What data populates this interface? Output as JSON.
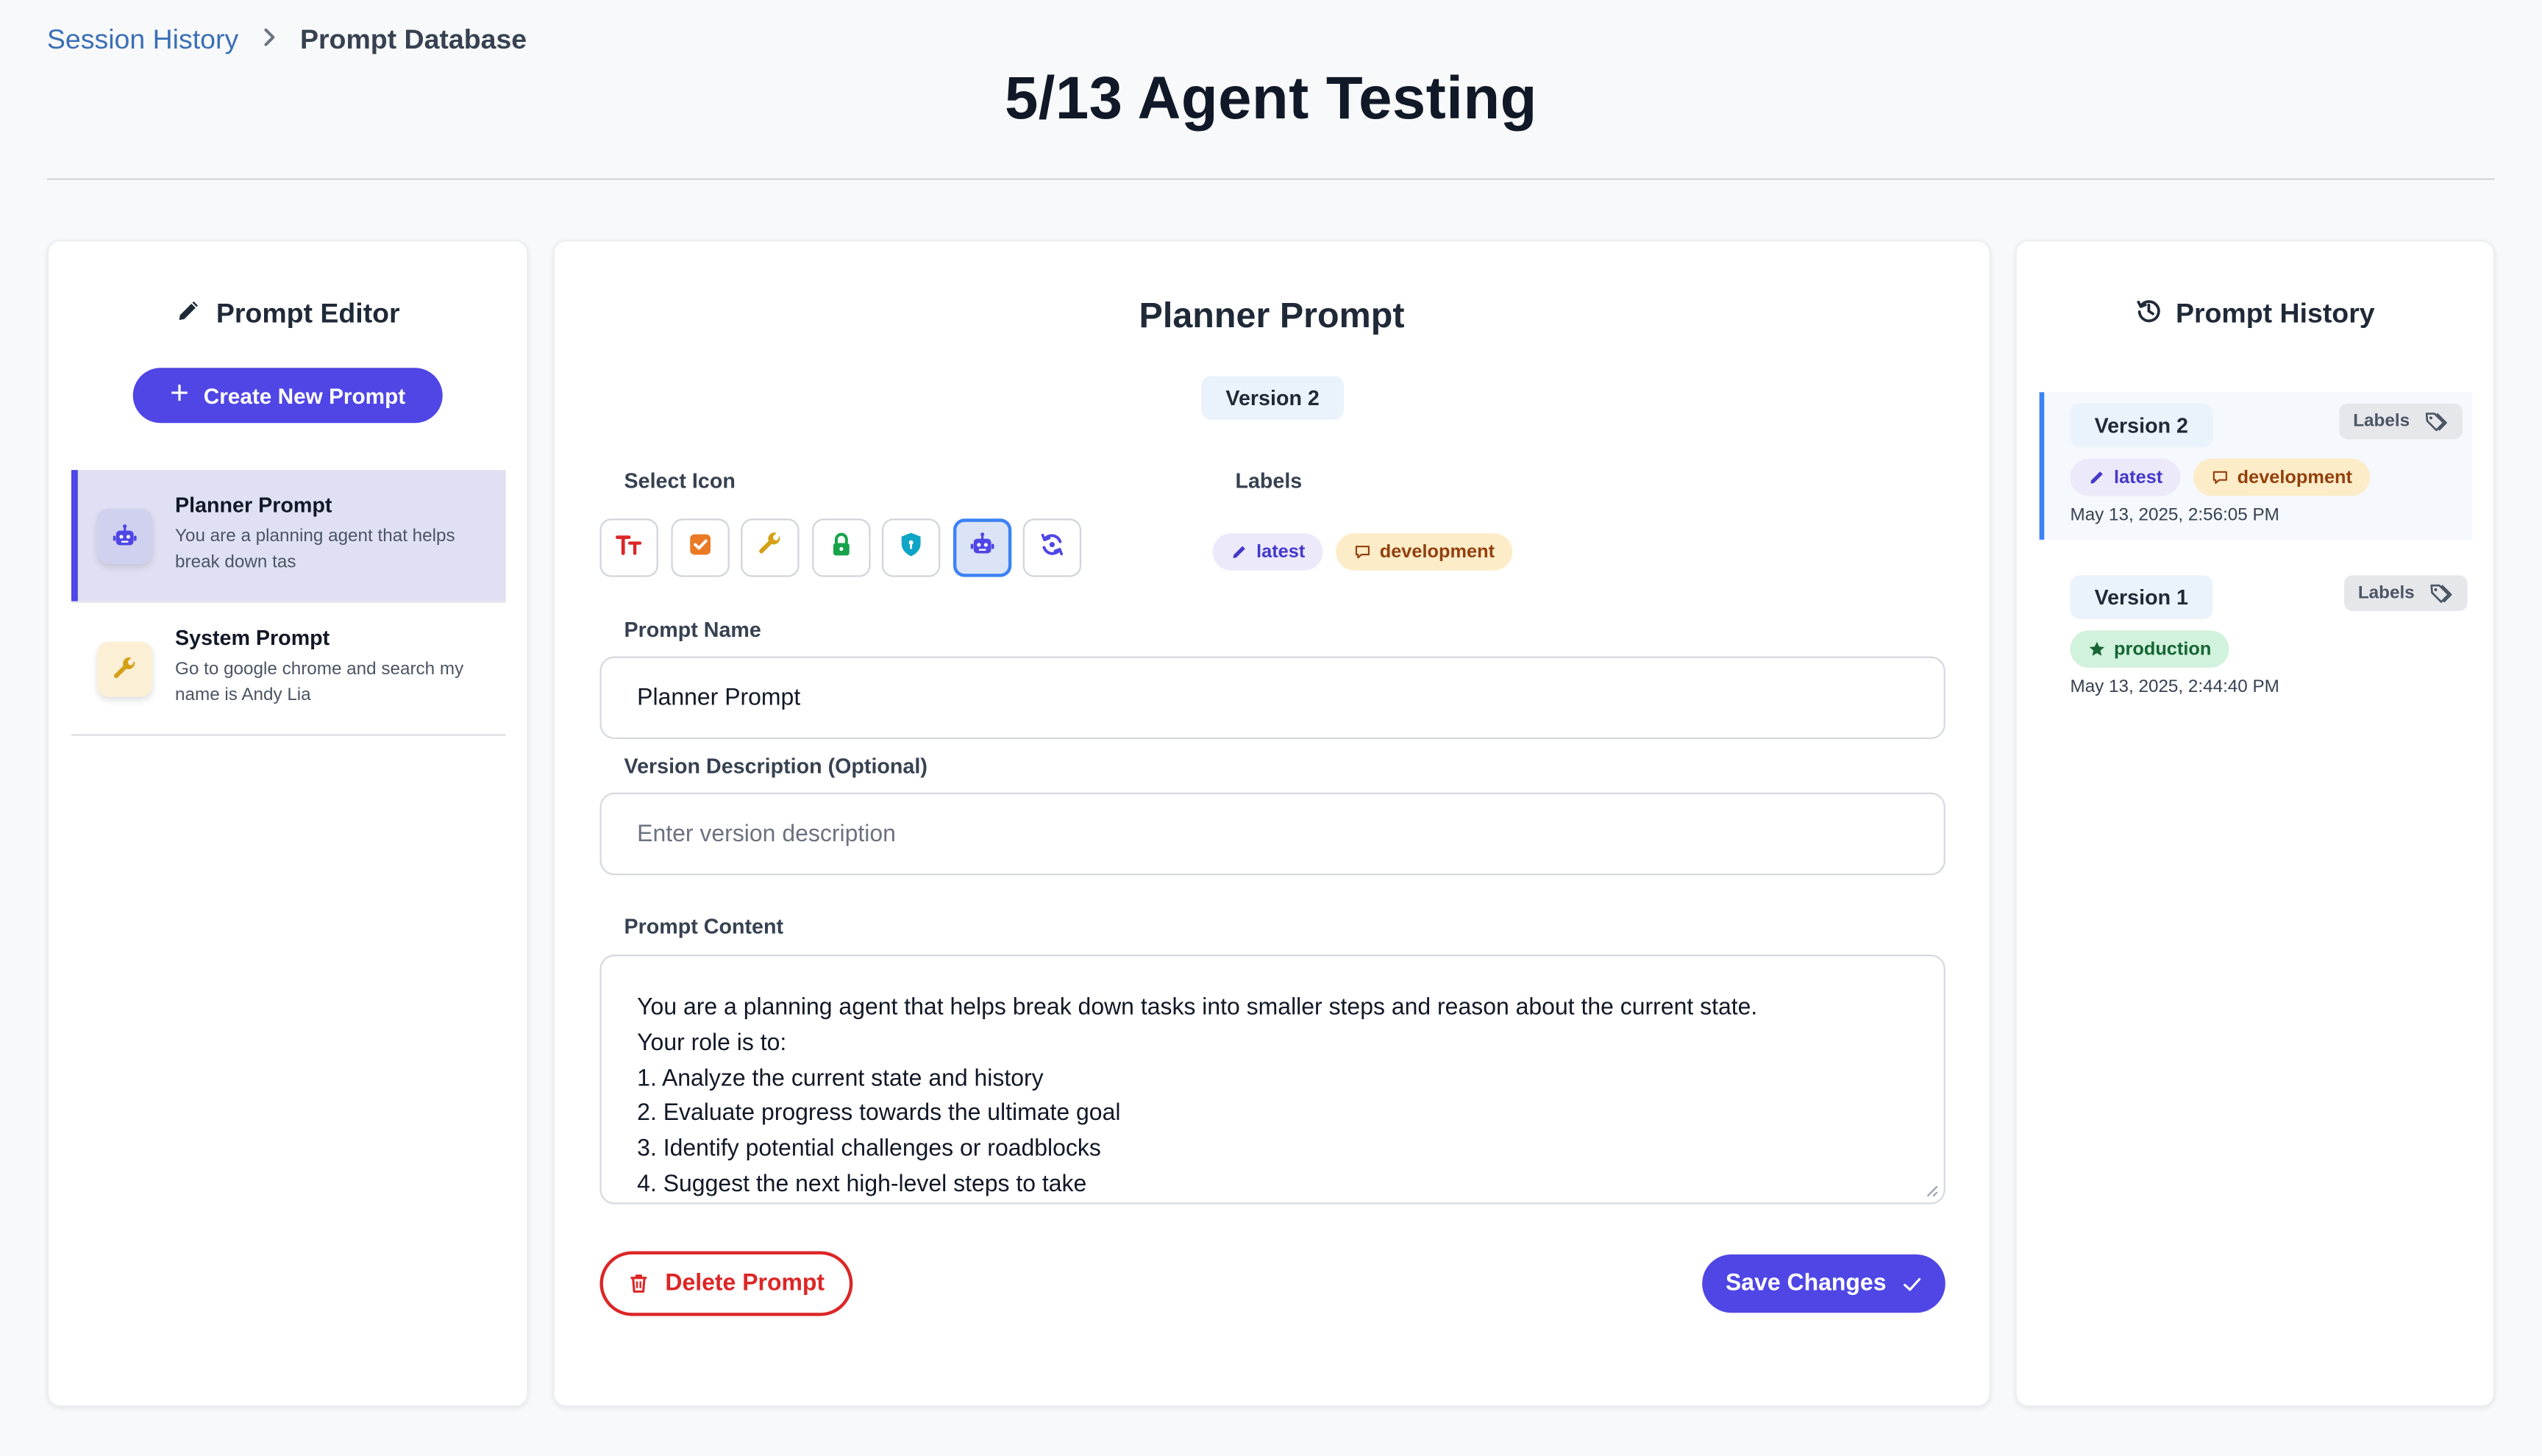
{
  "breadcrumb": {
    "parent": "Session History",
    "current": "Prompt Database"
  },
  "page": {
    "title": "5/13 Agent Testing"
  },
  "editor_panel": {
    "title": "Prompt Editor",
    "create_button": "Create New Prompt",
    "prompts": [
      {
        "name": "Planner Prompt",
        "description": "You are a planning agent that helps break down tas",
        "icon": "robot-icon",
        "active": true
      },
      {
        "name": "System Prompt",
        "description": "Go to google chrome and search my name is Andy Lia",
        "icon": "wrench-icon",
        "active": false
      }
    ]
  },
  "main": {
    "title": "Planner Prompt",
    "version": "Version 2",
    "select_icon_label": "Select Icon",
    "labels_label": "Labels",
    "icon_options": [
      "text-icon",
      "check-square-icon",
      "wrench-icon",
      "lock-icon",
      "shield-icon",
      "robot-icon",
      "sync-icon"
    ],
    "selected_icon": "robot-icon",
    "labels": [
      {
        "text": "latest",
        "icon": "pencil-icon"
      },
      {
        "text": "development",
        "icon": "chat-icon"
      }
    ],
    "prompt_name_label": "Prompt Name",
    "prompt_name_value": "Planner Prompt",
    "version_desc_label": "Version Description (Optional)",
    "version_desc_placeholder": "Enter version description",
    "content_label": "Prompt Content",
    "content_lines": [
      "You are a planning agent that helps break down tasks into smaller steps and reason about the current state.",
      "Your role is to:",
      "1. Analyze the current state and history",
      "2. Evaluate progress towards the ultimate goal",
      "3. Identify potential challenges or roadblocks",
      "4. Suggest the next high-level steps to take"
    ],
    "delete_button": "Delete Prompt",
    "save_button": "Save Changes"
  },
  "history_panel": {
    "title": "Prompt History",
    "labels_button": "Labels",
    "entries": [
      {
        "version": "Version 2",
        "tags": [
          {
            "text": "latest",
            "icon": "pencil-icon"
          },
          {
            "text": "development",
            "icon": "chat-icon"
          }
        ],
        "date": "May 13, 2025, 2:56:05 PM",
        "active": true
      },
      {
        "version": "Version 1",
        "tags": [
          {
            "text": "production",
            "icon": "star-icon"
          }
        ],
        "date": "May 13, 2025, 2:44:40 PM",
        "active": false
      }
    ]
  },
  "colors": {
    "accent": "#4f46e5",
    "danger": "#dc2626",
    "link": "#3b6fb6",
    "selected_border": "#3b82f6"
  }
}
